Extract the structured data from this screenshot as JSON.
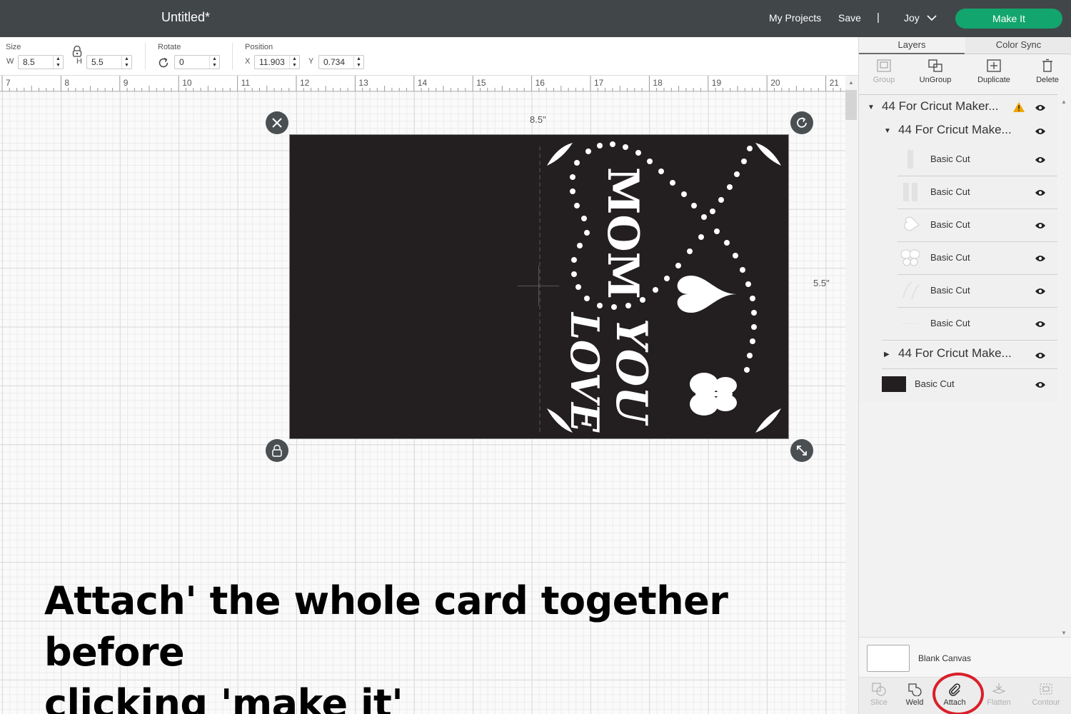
{
  "topbar": {
    "title": "Untitled*",
    "my_projects": "My Projects",
    "save": "Save",
    "separator": "|",
    "user": "Joy",
    "make_it": "Make It",
    "accent_color": "#12a56d"
  },
  "toolbar": {
    "size_label": "Size",
    "w_label": "W",
    "w_value": "8.5",
    "h_label": "H",
    "h_value": "5.5",
    "rotate_label": "Rotate",
    "rotate_value": "0",
    "position_label": "Position",
    "x_label": "X",
    "x_value": "11.903",
    "y_label": "Y",
    "y_value": "0.734"
  },
  "ruler": {
    "labels": [
      "7",
      "8",
      "9",
      "10",
      "11",
      "12",
      "13",
      "14",
      "15",
      "16",
      "17",
      "18",
      "19",
      "20",
      "21"
    ]
  },
  "canvas": {
    "width_label": "8.5\"",
    "height_label": "5.5\"",
    "card_text_1": "MOM",
    "card_text_2": "LOVE",
    "card_text_3": "YOU",
    "caption_line1": "Attach' the whole card together before",
    "caption_line2": "clicking 'make it'"
  },
  "panel": {
    "tab_layers": "Layers",
    "tab_color_sync": "Color Sync",
    "tools": {
      "group": "Group",
      "ungroup": "UnGroup",
      "duplicate": "Duplicate",
      "delete": "Delete"
    },
    "layers": {
      "group1": "44 For Cricut Maker...",
      "group1_sub": "44 For Cricut Make...",
      "items": [
        "Basic Cut",
        "Basic Cut",
        "Basic Cut",
        "Basic Cut",
        "Basic Cut",
        "Basic Cut"
      ],
      "group2": "44 For Cricut Make...",
      "base": "Basic Cut"
    },
    "blank_canvas": "Blank Canvas",
    "bottom_tools": {
      "slice": "Slice",
      "weld": "Weld",
      "attach": "Attach",
      "flatten": "Flatten",
      "contour": "Contour"
    },
    "warning_color": "#f0a500",
    "highlight_color": "#d9202a"
  }
}
